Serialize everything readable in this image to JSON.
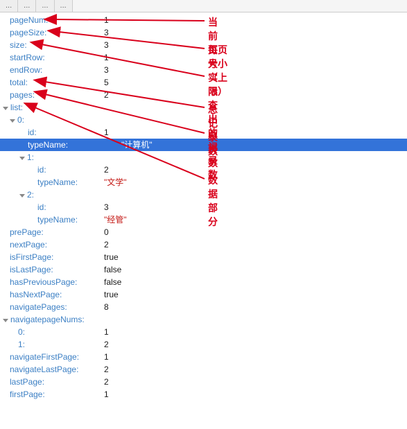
{
  "tabs": [
    "...",
    "...",
    "...",
    "..."
  ],
  "props": {
    "pageNum": {
      "k": "pageNum:",
      "v": "1"
    },
    "pageSize": {
      "k": "pageSize:",
      "v": "3"
    },
    "size": {
      "k": "size:",
      "v": "3"
    },
    "startRow": {
      "k": "startRow:",
      "v": "1"
    },
    "endRow": {
      "k": "endRow:",
      "v": "3"
    },
    "total": {
      "k": "total:",
      "v": "5"
    },
    "pages": {
      "k": "pages:",
      "v": "2"
    },
    "list": {
      "k": "list:"
    },
    "list0": {
      "k": "0:"
    },
    "list0_id": {
      "k": "id:",
      "v": "1"
    },
    "list0_typeName": {
      "k": "typeName:",
      "v": "\"计算机\""
    },
    "list1": {
      "k": "1:"
    },
    "list1_id": {
      "k": "id:",
      "v": "2"
    },
    "list1_typeName": {
      "k": "typeName:",
      "v": "\"文学\""
    },
    "list2": {
      "k": "2:"
    },
    "list2_id": {
      "k": "id:",
      "v": "3"
    },
    "list2_typeName": {
      "k": "typeName:",
      "v": "\"经管\""
    },
    "prePage": {
      "k": "prePage:",
      "v": "0"
    },
    "nextPage": {
      "k": "nextPage:",
      "v": "2"
    },
    "isFirstPage": {
      "k": "isFirstPage:",
      "v": "true"
    },
    "isLastPage": {
      "k": "isLastPage:",
      "v": "false"
    },
    "hasPreviousPage": {
      "k": "hasPreviousPage:",
      "v": "false"
    },
    "hasNextPage": {
      "k": "hasNextPage:",
      "v": "true"
    },
    "navigatePages": {
      "k": "navigatePages:",
      "v": "8"
    },
    "navigatepageNums": {
      "k": "navigatepageNums:"
    },
    "nav0": {
      "k": "0:",
      "v": "1"
    },
    "nav1": {
      "k": "1:",
      "v": "2"
    },
    "navigateFirstPage": {
      "k": "navigateFirstPage:",
      "v": "1"
    },
    "navigateLastPage": {
      "k": "navigateLastPage:",
      "v": "2"
    },
    "lastPage": {
      "k": "lastPage:",
      "v": "2"
    },
    "firstPage": {
      "k": "firstPage:",
      "v": "1"
    }
  },
  "annotations": {
    "a1": "当前页号",
    "a2": "每页大小（上限）",
    "a3": "实际查出的记录数",
    "a4": "总记录数",
    "a5": "总页数",
    "a6": "数据部分"
  }
}
